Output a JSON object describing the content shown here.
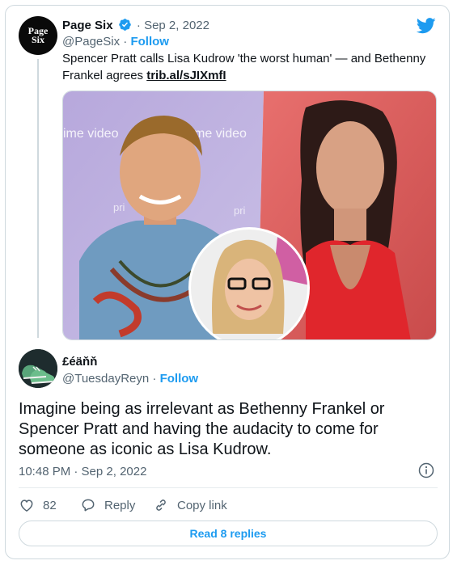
{
  "parent_tweet": {
    "avatar_text": [
      "Page",
      "Six"
    ],
    "display_name": "Page Six",
    "date": "Sep 2, 2022",
    "handle": "@PageSix",
    "follow_label": "Follow",
    "text": "Spencer Pratt calls Lisa Kudrow 'the worst human' — and Bethenny Frankel agrees ",
    "link": "trib.al/sJIXmfI",
    "media_watermarks": [
      "ime video",
      "me video",
      "pri",
      "pri"
    ]
  },
  "reply_tweet": {
    "display_name": "£éäňň",
    "handle": "@TuesdayReyn",
    "follow_label": "Follow",
    "text": "Imagine being as irrelevant as Bethenny Frankel or Spencer Pratt and having the audacity to come for someone as iconic as Lisa Kudrow.",
    "timestamp": "10:48 PM · Sep 2, 2022"
  },
  "actions": {
    "like_count": "82",
    "reply_label": "Reply",
    "copy_label": "Copy link"
  },
  "read_replies_label": "Read 8 replies",
  "colors": {
    "accent": "#1d9bf0",
    "muted": "#536471",
    "border": "#cfd9de"
  }
}
